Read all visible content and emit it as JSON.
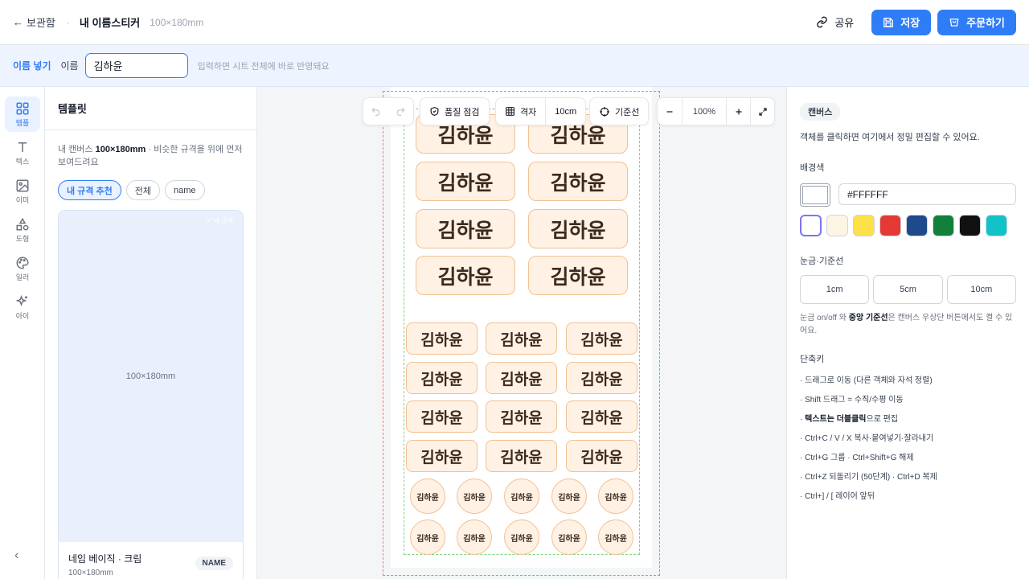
{
  "header": {
    "back_label": "보관함",
    "separator": "·",
    "title": "내 이름스티커",
    "size": "100×180mm",
    "share_label": "공유",
    "save_label": "저장",
    "order_label": "주문하기"
  },
  "namebar": {
    "label": "이름 넣기",
    "field_label": "이름",
    "value": "김하윤",
    "hint": "입력하면 시트 전체에 바로 반영돼요"
  },
  "rail": {
    "items": [
      {
        "label": "템플",
        "icon": "grid-icon",
        "active": true
      },
      {
        "label": "텍스",
        "icon": "text-icon"
      },
      {
        "label": "이미",
        "icon": "image-icon"
      },
      {
        "label": "도형",
        "icon": "shapes-icon"
      },
      {
        "label": "일러",
        "icon": "palette-icon"
      },
      {
        "label": "아이",
        "icon": "sparkle-icon"
      }
    ]
  },
  "templates": {
    "title": "템플릿",
    "desc_prefix": "내 캔버스 ",
    "desc_size": "100×180mm",
    "desc_suffix": " · 비슷한 규격을 위에 먼저 보여드려요",
    "chips": [
      "내 규격 추천",
      "전체",
      "name"
    ],
    "card": {
      "thumb_label": "100×180mm",
      "badge": "✔ 내 규격",
      "name": "네임 베이직 · 크림",
      "size": "100×180mm",
      "tag": "NAME"
    }
  },
  "toolbar": {
    "quality_label": "품질 점검",
    "grid_label": "격자",
    "grid_value": "10cm",
    "guide_label": "기준선",
    "zoom": "100%"
  },
  "canvas": {
    "sticker_text": "김하윤",
    "colors": {
      "fill": "#FFF1E3",
      "border": "#F1C193",
      "bleed": "#F07A7A",
      "safe": "#7DD37D"
    }
  },
  "props": {
    "tag": "캔버스",
    "hint": "객체를 클릭하면 여기에서 정밀 편집할 수 있어요.",
    "bg_title": "배경색",
    "bg_hex": "#FFFFFF",
    "swatches": [
      "#FFFFFF",
      "#FDF5E4",
      "#FDE047",
      "#E53935",
      "#1E4A8C",
      "#12803A",
      "#111111",
      "#12C2C8"
    ],
    "grid_title": "눈금·기준선",
    "grid_options": [
      "1cm",
      "5cm",
      "10cm"
    ],
    "grid_note_prefix": "눈금 on/off 와 ",
    "grid_note_bold": "중앙 기준선",
    "grid_note_suffix": "은 캔버스 우상단 버튼에서도 켤 수 있어요.",
    "shortcut_title": "단축키",
    "shortcuts": [
      "· 드래그로 이동 (다른 객체와 자석 정렬)",
      "· Shift 드래그 = 수직/수평 이동",
      "· Ctrl+C / V / X 복사·붙여넣기·잘라내기",
      "· Ctrl+G 그룹 · Ctrl+Shift+G 해제",
      "· Ctrl+Z 되돌리기 (50단계) · Ctrl+D 복제",
      "· Ctrl+] / [ 레이어 앞뒤"
    ],
    "shortcut_dblclick_bold": "텍스트는 더블클릭",
    "shortcut_dblclick_suffix": "으로 편집",
    "shortcut_dblclick_prefix": "· "
  }
}
